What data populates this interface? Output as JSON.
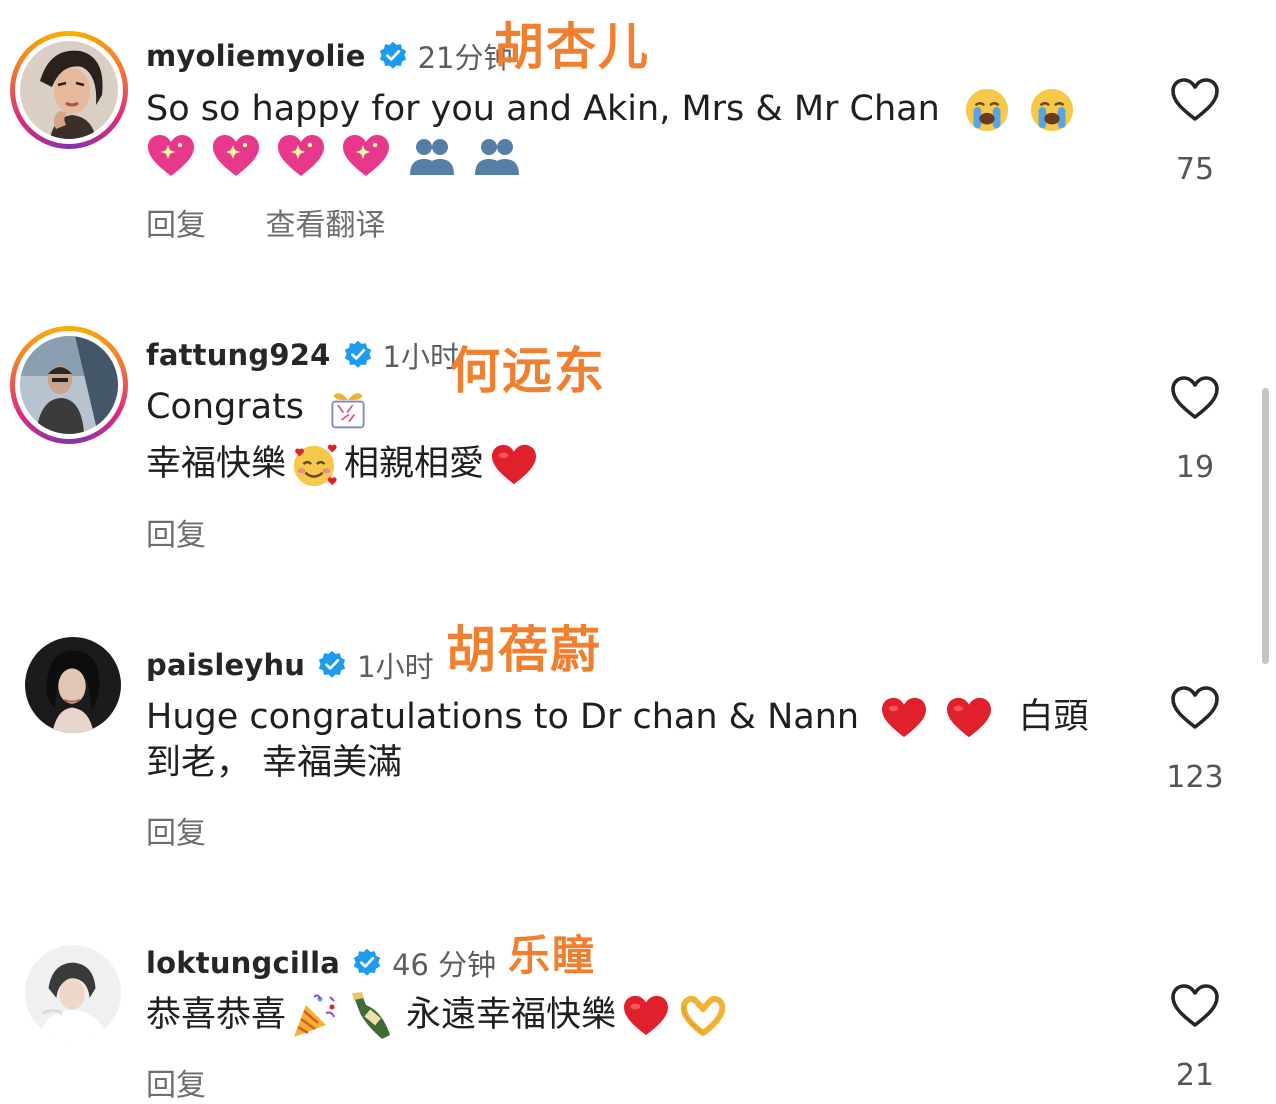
{
  "comments": [
    {
      "username": "myoliemyolie",
      "time": "21分钟",
      "overlay": "胡杏儿",
      "line1": "So so happy for you and Akin, Mrs & Mr Chan",
      "reply": "回复",
      "translate": "查看翻译",
      "likes": "75",
      "avatar": "woman-with-hand-pose"
    },
    {
      "username": "fattung924",
      "time": "1小时",
      "overlay": "何远东",
      "line1": "Congrats",
      "line2a": "幸福快樂",
      "line2b": "相親相愛",
      "reply": "回复",
      "likes": "19",
      "avatar": "man-in-car"
    },
    {
      "username": "paisleyhu",
      "time": "1小时",
      "overlay": "胡蓓蔚",
      "line1": "Huge congratulations to Dr chan & Nann",
      "line1b": "白頭",
      "line2": "到老， 幸福美滿",
      "reply": "回复",
      "likes": "123",
      "avatar": "woman-dark-portrait"
    },
    {
      "username": "loktungcilla",
      "time": "46 分钟",
      "overlay": "乐瞳",
      "line1a": "恭喜恭喜",
      "line1b": "永遠幸福快樂",
      "reply": "回复",
      "likes": "21",
      "avatar": "woman-light-portrait"
    }
  ],
  "icons": {
    "verified": "verified-badge-icon",
    "like": "heart-outline-icon"
  },
  "colors": {
    "verified_blue": "#1d9bf0",
    "overlay_orange": "#f07f2f",
    "heart_red": "#e0202a"
  }
}
